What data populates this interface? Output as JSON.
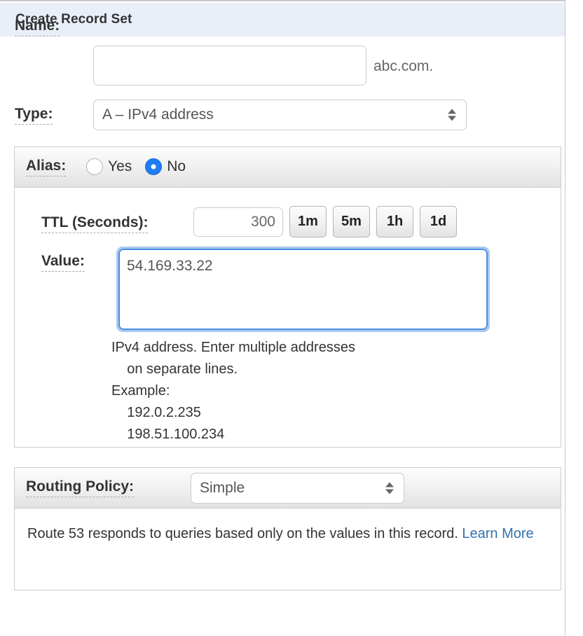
{
  "header": {
    "title": "Create Record Set",
    "background": "#e9eff9"
  },
  "form": {
    "name": {
      "label": "Name:",
      "value": "",
      "placeholder": "",
      "suffix": "abc.com."
    },
    "type": {
      "label": "Type:",
      "selected": "A – IPv4 address"
    },
    "alias": {
      "label": "Alias:",
      "options": [
        {
          "label": "Yes",
          "selected": false
        },
        {
          "label": "No",
          "selected": true
        }
      ],
      "selected_color": "#1f7cf2"
    },
    "ttl": {
      "label": "TTL (Seconds):",
      "value": "300",
      "placeholder": "",
      "presets": [
        "1m",
        "5m",
        "1h",
        "1d"
      ]
    },
    "value": {
      "label": "Value:",
      "content": "54.169.33.22",
      "placeholder": "",
      "focused": true,
      "focus_border_color": "#4a8fe0",
      "helper_text": "IPv4 address. Enter multiple addresses\n    on separate lines.\nExample:\n    192.0.2.235\n    198.51.100.234"
    },
    "routing_policy": {
      "label": "Routing Policy:",
      "selected": "Simple",
      "description": "Route 53 responds to queries based only on the values in this record. ",
      "link_text": "Learn More",
      "link_color": "#3572b0"
    }
  }
}
